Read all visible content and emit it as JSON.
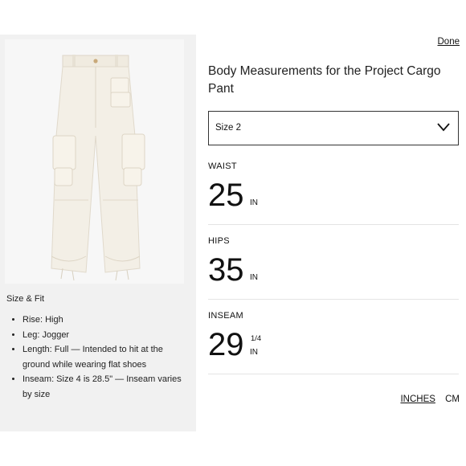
{
  "done_label": "Done",
  "title": "Body Measurements for the Project Cargo Pant",
  "size_select": {
    "value": "Size 2"
  },
  "measurements": [
    {
      "label": "WAIST",
      "value": "25",
      "fraction": "",
      "unit": "IN"
    },
    {
      "label": "HIPS",
      "value": "35",
      "fraction": "",
      "unit": "IN"
    },
    {
      "label": "INSEAM",
      "value": "29",
      "fraction": "1/4",
      "unit": "IN"
    }
  ],
  "units": {
    "inches": "INCHES",
    "cm": "CM",
    "active": "inches"
  },
  "size_fit": {
    "title": "Size & Fit",
    "items": [
      "Rise: High",
      "Leg: Jogger",
      "Length: Full — Intended to hit at the ground while wearing flat shoes",
      "Inseam: Size 4 is 28.5\" — Inseam varies by size"
    ]
  },
  "colors": {
    "panel": "#f1f1f1",
    "product": "#f3efe6"
  }
}
